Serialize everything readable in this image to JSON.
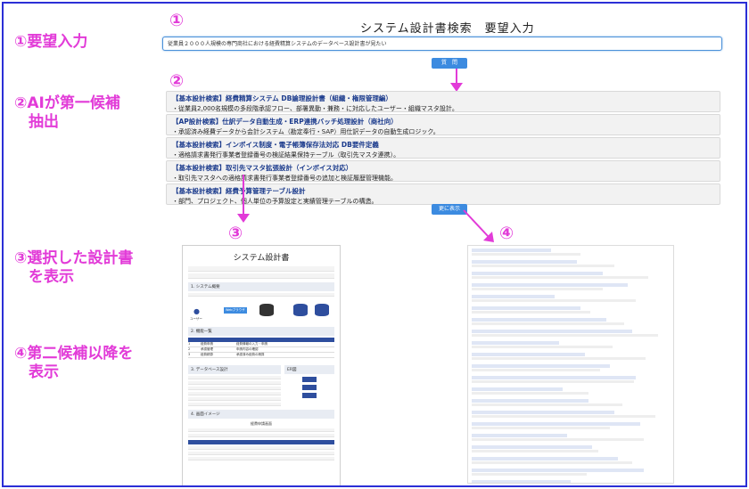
{
  "app": {
    "title": "システム設計書検索　要望入力"
  },
  "search": {
    "value": "従業員２０００人規模の専門商社における経費精算システムのデータベース設計書が見たい",
    "button_label": "質　問"
  },
  "steps": {
    "s1": "①要望入力",
    "s2_line1": "②AIが第一候補",
    "s2_line2": "抽出",
    "s3_line1": "③選択した設計書",
    "s3_line2": "を表示",
    "s4_line1": "④第二候補以降を",
    "s4_line2": "表示"
  },
  "markers": {
    "m1": "①",
    "m2": "②",
    "m3": "③",
    "m4": "④"
  },
  "results": [
    {
      "title": "【基本設計検索】経費精算システム DB論理設計書（組織・権限管理編）",
      "desc": "・従業員2,000名規模の多段階承認フロー、部署異動・兼務・に対応したユーザー・組織マスタ設計。"
    },
    {
      "title": "【AP設計検索】仕訳データ自動生成・ERP連携バッチ処理設計（商社向）",
      "desc": "・承認済み経費データから会計システム（勘定奉行・SAP）用仕訳データの自動生成ロジック。"
    },
    {
      "title": "【基本設計検索】インボイス制度・電子帳簿保存法対応 DB要件定義",
      "desc": "・適格請求書発行事業者登録番号の検証結果保持テーブル（取引先マスタ連携）。"
    },
    {
      "title": "【基本設計検索】取引先マスタ拡張設計（インボイス対応）",
      "desc": "・取引先マスタへの適格請求書発行事業者登録番号の追加と検証履歴管理機能。"
    },
    {
      "title": "【基本設計検索】経費予算管理テーブル設計",
      "desc": "・部門、プロジェクト、個人単位の予算設定と実績管理テーブルの構造。"
    }
  ],
  "more_button_label": "更に表示",
  "document": {
    "title": "システム設計書",
    "section1": "1. システム概要",
    "section2": "2. 機能一覧",
    "section3": "3. データベース設計",
    "section3b": "ER図",
    "section4": "4. 画面イメージ",
    "web_browser": "Webブラウザ",
    "user_label": "ユーザー",
    "funcs": [
      {
        "no": "1",
        "name": "経費申請",
        "desc": "経費情報の入力・申請"
      },
      {
        "no": "2",
        "name": "承認管理",
        "desc": "申請内容の確認"
      },
      {
        "no": "3",
        "name": "経費精算",
        "desc": "承認済み経費の精算"
      }
    ],
    "screen_title": "経費申請画面"
  }
}
